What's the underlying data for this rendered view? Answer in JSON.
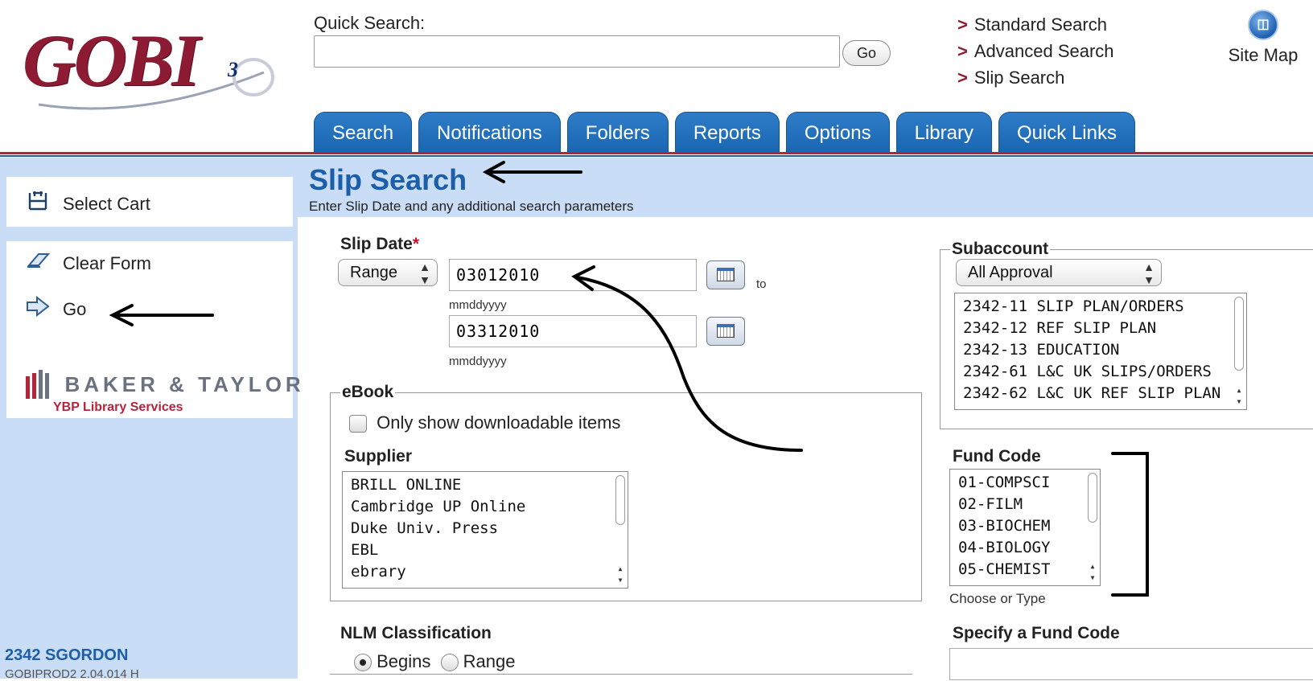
{
  "header": {
    "logo_text": "GOBI",
    "logo_version": "3",
    "quick_search_label": "Quick Search:",
    "quick_search_value": "",
    "go_label": "Go",
    "links": [
      "Standard Search",
      "Advanced Search",
      "Slip Search"
    ],
    "link_marker": ">",
    "site_map_label": "Site Map"
  },
  "tabs": [
    "Search",
    "Notifications",
    "Folders",
    "Reports",
    "Options",
    "Library",
    "Quick Links"
  ],
  "sidebar": {
    "select_cart": "Select Cart",
    "clear_form": "Clear Form",
    "go": "Go",
    "brand_name": "BAKER & TAYLOR",
    "brand_sub": "YBP Library Services",
    "user_id": "2342 SGORDON",
    "build": "GOBIPROD2 2.04.014 H"
  },
  "main": {
    "title": "Slip Search",
    "subtitle": "Enter Slip Date and any additional search parameters",
    "slip_date": {
      "label": "Slip Date",
      "required_marker": "*",
      "mode": "Range",
      "from": "03012010",
      "to": "03312010",
      "format_hint": "mmddyyyy",
      "to_word": "to"
    },
    "ebook": {
      "legend": "eBook",
      "only_downloadable": "Only show downloadable items",
      "only_downloadable_checked": false
    },
    "supplier": {
      "label": "Supplier",
      "options": [
        "BRILL ONLINE",
        "Cambridge UP Online",
        "Duke Univ. Press",
        "EBL",
        "ebrary"
      ]
    },
    "nlm": {
      "label": "NLM Classification",
      "options": [
        "Begins",
        "Range"
      ],
      "selected": "Begins"
    },
    "subaccount": {
      "legend": "Subaccount",
      "selected": "All Approval",
      "options": [
        "2342-11 SLIP PLAN/ORDERS",
        "2342-12 REF SLIP PLAN",
        "2342-13 EDUCATION",
        "2342-61 L&C UK SLIPS/ORDERS",
        "2342-62 L&C UK REF SLIP PLAN"
      ]
    },
    "fund_code": {
      "label": "Fund Code",
      "options": [
        "01-COMPSCI",
        "02-FILM",
        "03-BIOCHEM",
        "04-BIOLOGY",
        "05-CHEMIST"
      ],
      "hint": "Choose or Type"
    },
    "specify_fund_code": {
      "label": "Specify a Fund Code"
    }
  }
}
